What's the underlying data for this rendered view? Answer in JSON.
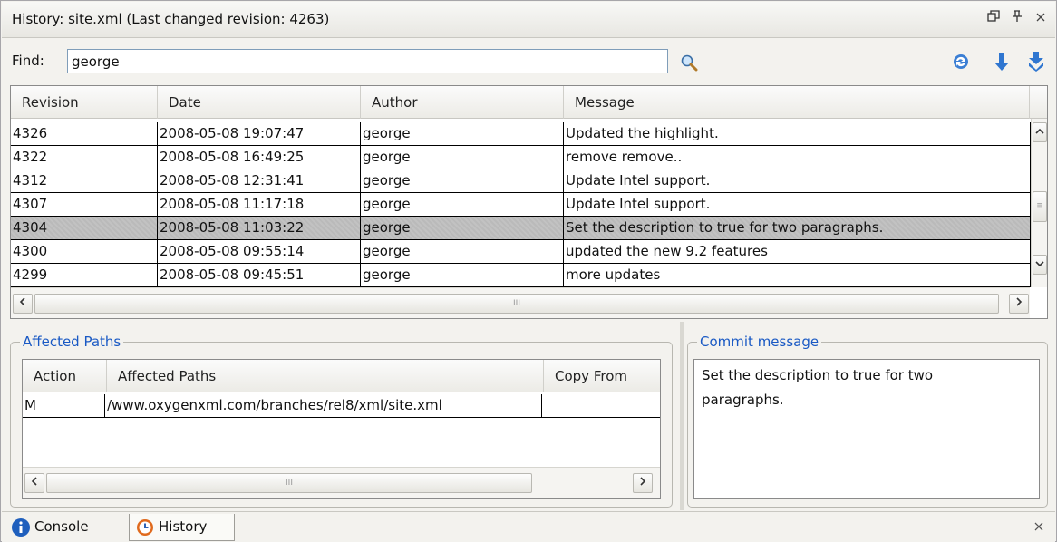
{
  "window": {
    "title": "History: site.xml (Last changed revision: 4263)"
  },
  "find": {
    "label": "Find:",
    "value": "george"
  },
  "history_table": {
    "columns": [
      "Revision",
      "Date",
      "Author",
      "Message"
    ],
    "rows": [
      {
        "revision": "4326",
        "date": "2008-05-08 19:07:47",
        "author": "george",
        "message": "Updated the highlight."
      },
      {
        "revision": "4322",
        "date": "2008-05-08 16:49:25",
        "author": "george",
        "message": "remove remove.."
      },
      {
        "revision": "4312",
        "date": "2008-05-08 12:31:41",
        "author": "george",
        "message": "Update Intel support."
      },
      {
        "revision": "4307",
        "date": "2008-05-08 11:17:18",
        "author": "george",
        "message": "Update Intel support."
      },
      {
        "revision": "4304",
        "date": "2008-05-08 11:03:22",
        "author": "george",
        "message": "Set the description to true for two paragraphs."
      },
      {
        "revision": "4300",
        "date": "2008-05-08 09:55:14",
        "author": "george",
        "message": "updated the new 9.2 features"
      },
      {
        "revision": "4299",
        "date": "2008-05-08 09:45:51",
        "author": "george",
        "message": "more updates"
      }
    ],
    "selected_index": 4
  },
  "affected_paths": {
    "title": "Affected Paths",
    "columns": [
      "Action",
      "Affected Paths",
      "Copy From"
    ],
    "rows": [
      {
        "action": "M",
        "path": "/www.oxygenxml.com/branches/rel8/xml/site.xml",
        "copy_from": ""
      }
    ]
  },
  "commit_message": {
    "title": "Commit message",
    "text_line1": "Set the description to true for two",
    "text_line2": "paragraphs."
  },
  "tabs": [
    {
      "label": "Console",
      "icon": "info-icon",
      "active": false
    },
    {
      "label": "History",
      "icon": "history-icon",
      "active": true
    }
  ],
  "colors": {
    "accent_blue": "#1959c4",
    "selection": "#c2c2c2"
  },
  "scroll_grip": "III"
}
